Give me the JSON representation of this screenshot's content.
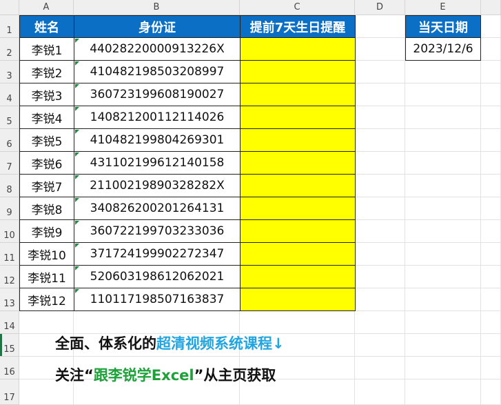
{
  "spreadsheet": {
    "columns": [
      "A",
      "B",
      "C",
      "D",
      "E"
    ],
    "rows": [
      "1",
      "2",
      "3",
      "4",
      "5",
      "6",
      "7",
      "8",
      "9",
      "10",
      "11",
      "12",
      "13",
      "14",
      "15",
      "16",
      "17"
    ],
    "table_headers": {
      "name": "姓名",
      "id": "身份证",
      "reminder": "提前7天生日提醒"
    },
    "records": [
      {
        "name": "李锐1",
        "id": "44028220000913226X"
      },
      {
        "name": "李锐2",
        "id": "410482198503208997"
      },
      {
        "name": "李锐3",
        "id": "360723199608190027"
      },
      {
        "name": "李锐4",
        "id": "140821200112114026"
      },
      {
        "name": "李锐5",
        "id": "410482199804269301"
      },
      {
        "name": "李锐6",
        "id": "431102199612140158"
      },
      {
        "name": "李锐7",
        "id": "21100219890328282X"
      },
      {
        "name": "李锐8",
        "id": "340826200201264131"
      },
      {
        "name": "李锐9",
        "id": "360722199703233036"
      },
      {
        "name": "李锐10",
        "id": "371724199902272347"
      },
      {
        "name": "李锐11",
        "id": "520603198612062021"
      },
      {
        "name": "李锐12",
        "id": "110117198507163837"
      }
    ],
    "today": {
      "label": "当天日期",
      "value": "2023/12/6"
    },
    "colors": {
      "header_bg": "#0b70c5",
      "highlight": "#ffff00",
      "error_marker": "#1e8a3c"
    }
  },
  "promo": {
    "line1_prefix": "全面、体系化的",
    "line1_highlight": "超清视频系统课程↓",
    "line2_prefix": "关注“",
    "line2_highlight": "跟李锐学Excel",
    "line2_suffix": "”从主页获取"
  }
}
